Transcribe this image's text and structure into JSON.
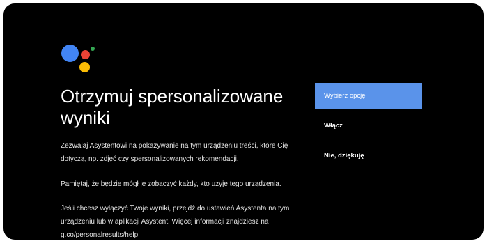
{
  "colors": {
    "background": "#000000",
    "selected": "#5a93ea",
    "logo_blue": "#4285f4",
    "logo_red": "#ea4335",
    "logo_yellow": "#fbbc05",
    "logo_green": "#34a853"
  },
  "logo": {
    "icon": "google-assistant-icon"
  },
  "content": {
    "title": "Otrzymuj spersonalizowane wyniki",
    "paragraph_1": "Zezwalaj Asystentowi na pokazywanie na tym urządzeniu treści, które Cię dotyczą, np. zdjęć czy spersonalizowanych rekomendacji.",
    "paragraph_2": "Pamiętaj, że będzie mógł je zobaczyć każdy, kto użyje tego urządzenia.",
    "paragraph_3": "Jeśli chcesz wyłączyć Twoje wyniki, przejdź do ustawień Asystenta na tym urządzeniu lub w aplikacji Asystent. Więcej informacji znajdziesz na g.co/personalresults/help"
  },
  "menu": {
    "items": [
      {
        "label": "Wybierz opcję",
        "selected": true
      },
      {
        "label": "Włącz",
        "selected": false
      },
      {
        "label": "Nie, dziękuję",
        "selected": false
      }
    ]
  }
}
